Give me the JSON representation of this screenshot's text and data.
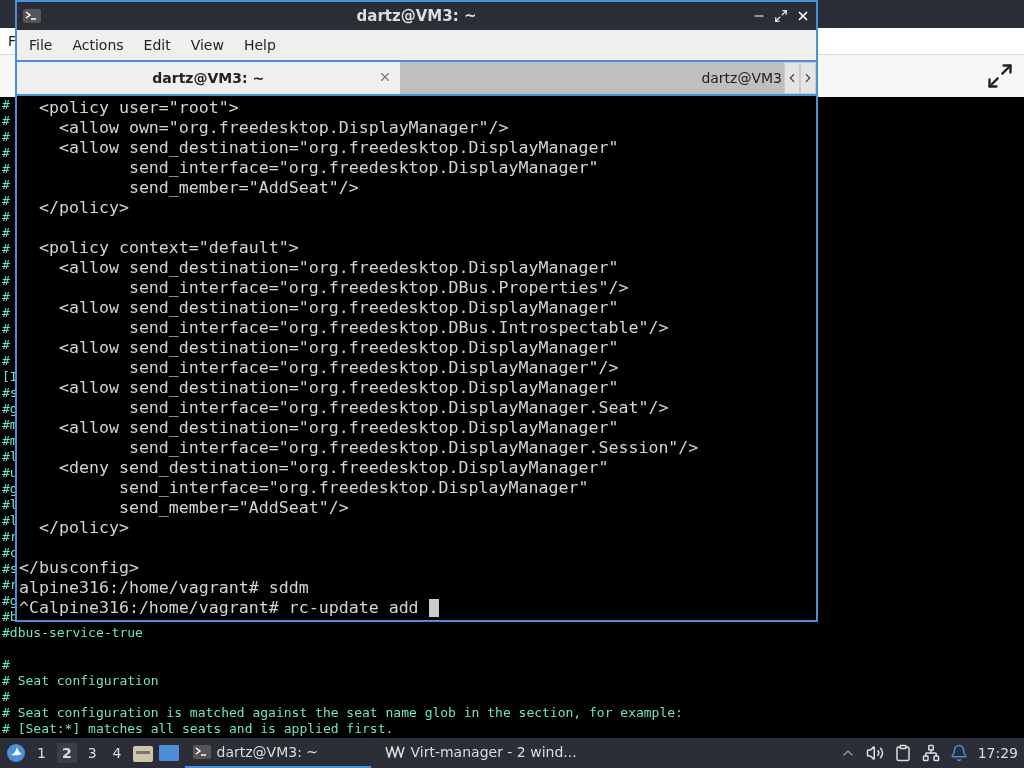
{
  "back_window": {
    "menu": [
      "F"
    ],
    "console_blocks": [
      [
        {
          "text": "#"
        },
        {
          "text": "#"
        },
        {
          "text": "#"
        },
        {
          "text": "#"
        },
        {
          "text": "#"
        },
        {
          "text": "#"
        },
        {
          "text": "#"
        },
        {
          "text": "#"
        },
        {
          "text": "#"
        },
        {
          "text": "#"
        },
        {
          "text": "#"
        },
        {
          "text": "#"
        },
        {
          "text": "#"
        },
        {
          "text": "#"
        },
        {
          "text": "#"
        },
        {
          "text": "#"
        },
        {
          "text": "#"
        },
        {
          "text": "[I"
        },
        {
          "text": "#s"
        },
        {
          "text": "#g"
        },
        {
          "text": "#m"
        },
        {
          "text": "#m"
        },
        {
          "text": "#l"
        },
        {
          "text": "#u"
        },
        {
          "text": "#g"
        },
        {
          "text": "#l"
        },
        {
          "text": "#l"
        },
        {
          "text": "#r"
        },
        {
          "text": "#c"
        },
        {
          "text": "#s"
        },
        {
          "text": "#r"
        },
        {
          "text": "#g"
        },
        {
          "text": "#b"
        },
        {
          "text": "#dbus-service-true"
        }
      ],
      [
        {
          "text": "#"
        },
        {
          "text": "# Seat configuration"
        },
        {
          "text": "#"
        },
        {
          "text": "# Seat configuration is matched against the seat name glob in the section, for example:"
        },
        {
          "text": "# [Seat:*] matches all seats and is applied first."
        }
      ]
    ]
  },
  "terminal": {
    "title": "dartz@VM3: ~",
    "menu": [
      "File",
      "Actions",
      "Edit",
      "View",
      "Help"
    ],
    "tabs": [
      {
        "label": "dartz@VM3: ~",
        "selected": true
      },
      {
        "label": "dartz@VM3",
        "selected": false
      }
    ],
    "blocks": [
      [
        {
          "text": "  <policy user=\"root\">"
        },
        {
          "text": "    <allow own=\"org.freedesktop.DisplayManager\"/>"
        },
        {
          "text": "    <allow send_destination=\"org.freedesktop.DisplayManager\""
        },
        {
          "text": "           send_interface=\"org.freedesktop.DisplayManager\""
        },
        {
          "text": "           send_member=\"AddSeat\"/>"
        },
        {
          "text": "  </policy>"
        }
      ],
      [
        {
          "text": "  <policy context=\"default\">"
        },
        {
          "text": "    <allow send_destination=\"org.freedesktop.DisplayManager\""
        },
        {
          "text": "           send_interface=\"org.freedesktop.DBus.Properties\"/>"
        },
        {
          "text": "    <allow send_destination=\"org.freedesktop.DisplayManager\""
        },
        {
          "text": "           send_interface=\"org.freedesktop.DBus.Introspectable\"/>"
        },
        {
          "text": "    <allow send_destination=\"org.freedesktop.DisplayManager\""
        },
        {
          "text": "           send_interface=\"org.freedesktop.DisplayManager\"/>"
        },
        {
          "text": "    <allow send_destination=\"org.freedesktop.DisplayManager\""
        },
        {
          "text": "           send_interface=\"org.freedesktop.DisplayManager.Seat\"/>"
        },
        {
          "text": "    <allow send_destination=\"org.freedesktop.DisplayManager\""
        },
        {
          "text": "           send_interface=\"org.freedesktop.DisplayManager.Session\"/>"
        },
        {
          "text": "    <deny send_destination=\"org.freedesktop.DisplayManager\""
        },
        {
          "text": "          send_interface=\"org.freedesktop.DisplayManager\""
        },
        {
          "text": "          send_member=\"AddSeat\"/>"
        },
        {
          "text": "  </policy>"
        }
      ],
      [
        {
          "text": "</busconfig>"
        },
        {
          "text": "alpine316:/home/vagrant# sddm"
        },
        {
          "text": "^Calpine316:/home/vagrant# rc-update add ",
          "cursor": true
        }
      ]
    ]
  },
  "taskbar": {
    "workspaces": [
      {
        "label": "1",
        "selected": false
      },
      {
        "label": "2",
        "selected": true
      },
      {
        "label": "3",
        "selected": false
      },
      {
        "label": "4",
        "selected": false
      }
    ],
    "tasks": [
      {
        "label": "dartz@VM3: ~",
        "kind": "terminal",
        "selected": true
      },
      {
        "label": "Virt-manager - 2 wind...",
        "kind": "virt",
        "selected": false
      }
    ],
    "clock": "17:29"
  }
}
